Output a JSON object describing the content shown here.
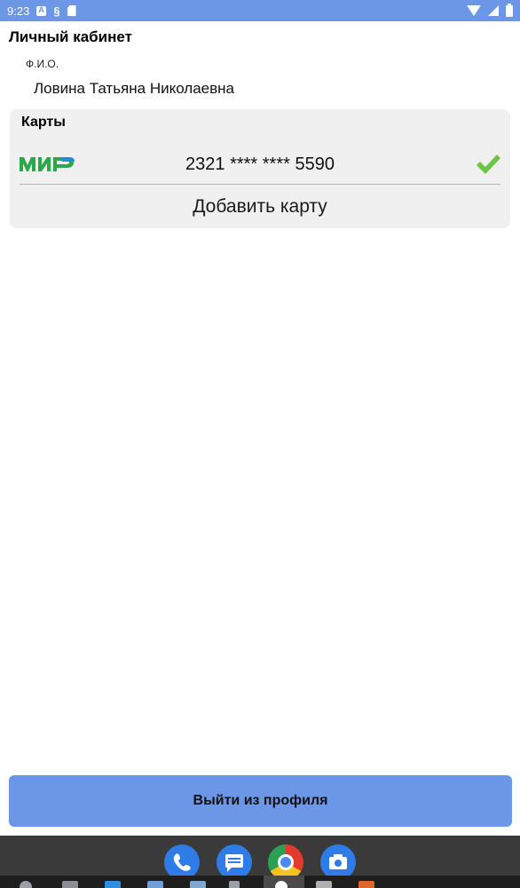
{
  "status_bar": {
    "time": "9:23",
    "icons": [
      "a-icon",
      "s-icon",
      "sd-card-icon",
      "wifi-icon",
      "signal-icon",
      "battery-icon"
    ]
  },
  "header": {
    "title": "Личный кабинет"
  },
  "profile": {
    "fio_label": "Ф.И.О.",
    "fio_value": "Ловина Татьяна Николаевна"
  },
  "cards": {
    "title": "Карты",
    "items": [
      {
        "brand": "МИР",
        "number": "2321 **** **** 5590",
        "selected": true
      }
    ],
    "add_label": "Добавить карту"
  },
  "logout": {
    "label": "Выйти из профиля"
  },
  "dock": {
    "apps": [
      "phone-icon",
      "messages-icon",
      "chrome-icon",
      "camera-icon"
    ]
  },
  "colors": {
    "accent": "#6c96e6",
    "panel": "#f0f0f0",
    "mir_green": "#2aa84a",
    "mir_blue": "#1e8fd6",
    "check_green": "#6cc644"
  }
}
